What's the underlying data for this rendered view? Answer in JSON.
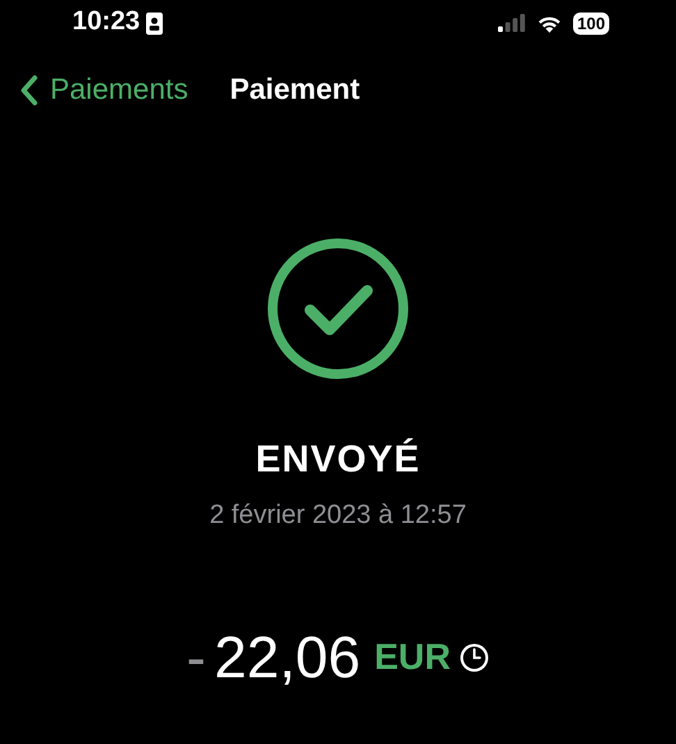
{
  "status_bar": {
    "time": "10:23",
    "battery": "100"
  },
  "nav": {
    "back_label": "Paiements",
    "title": "Paiement"
  },
  "payment": {
    "status": "ENVOYÉ",
    "date": "2 février 2023 à 12:57",
    "sign": "-",
    "amount": "22,06",
    "currency": "EUR"
  }
}
